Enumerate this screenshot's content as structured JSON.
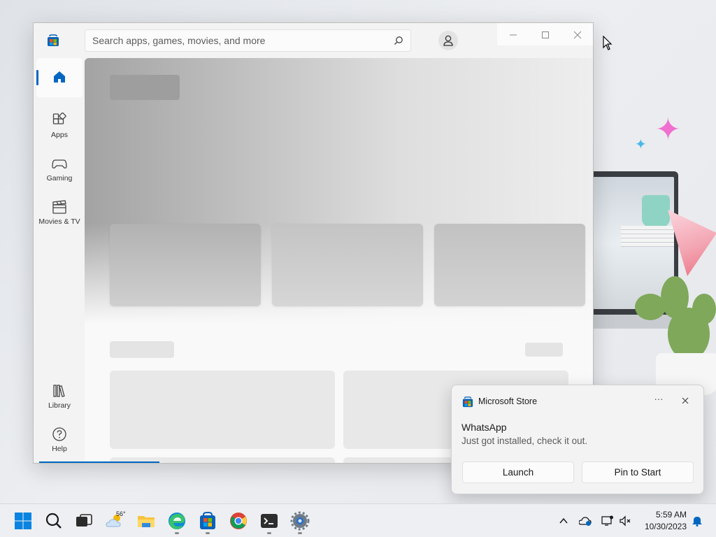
{
  "window": {
    "search": {
      "placeholder": "Search apps, games, movies, and more"
    },
    "nav": {
      "home": {
        "label": ""
      },
      "apps": {
        "label": "Apps"
      },
      "gaming": {
        "label": "Gaming"
      },
      "movies": {
        "label": "Movies & TV"
      },
      "library": {
        "label": "Library"
      },
      "help": {
        "label": "Help"
      }
    }
  },
  "toast": {
    "app_name": "Microsoft Store",
    "more": "···",
    "title": "WhatsApp",
    "body": "Just got installed, check it out.",
    "launch_label": "Launch",
    "pin_label": "Pin to Start"
  },
  "taskbar": {
    "weather_temp": "56°",
    "time": "5:59 AM",
    "date": "10/30/2023",
    "icons": [
      "windows-start-icon",
      "search-icon",
      "task-view-icon",
      "weather-icon",
      "file-explorer-icon",
      "edge-icon",
      "microsoft-store-icon",
      "chrome-icon",
      "terminal-icon",
      "settings-icon"
    ]
  },
  "colors": {
    "accent": "#0067c0",
    "window_bg": "#f3f3f3",
    "taskbar_bg": "#eeeff2"
  }
}
